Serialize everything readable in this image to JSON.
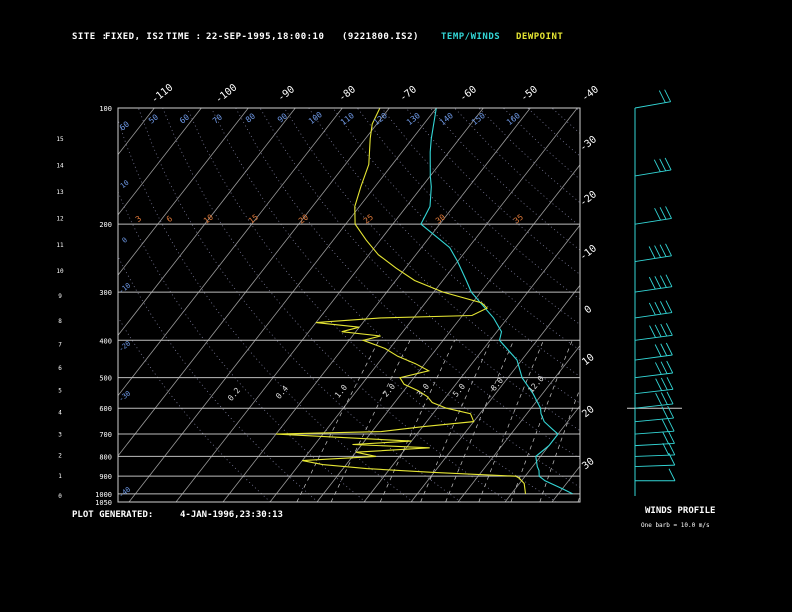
{
  "header": {
    "site_label": "SITE :",
    "site_value": "FIXED, IS2",
    "time_label": "TIME :",
    "time_value": "22-SEP-1995,18:00:10",
    "file_id": "(9221800.IS2)",
    "temp_legend": "TEMP/WINDS",
    "dew_legend": "DEWPOINT"
  },
  "colors": {
    "temp": "#33d6d6",
    "dewpoint": "#e6e633",
    "isotherm": "#9a9a9a",
    "isobar": "#bdbdbd",
    "dry_adiabat": "#7a7a9a",
    "mixing_ratio": "#c8c8c8",
    "theta_label": "#6f9ae8",
    "orange_label": "#e07a3a"
  },
  "footer": {
    "generated_label": "PLOT GENERATED:",
    "generated_value": "4-JAN-1996,23:30:13",
    "winds_title": "WINDS PROFILE",
    "winds_note": "One barb = 10.0 m/s"
  },
  "chart_data": {
    "type": "line",
    "pressure_levels": [
      100,
      200,
      300,
      400,
      500,
      600,
      700,
      800,
      900,
      1000,
      1050
    ],
    "height_ticks_km": [
      0,
      1,
      2,
      3,
      4,
      5,
      6,
      7,
      8,
      9,
      10,
      11,
      12,
      13,
      14,
      15
    ],
    "isotherm_labels_top": [
      "-110",
      "-100",
      "-90",
      "-80",
      "-70",
      "-60",
      "-50",
      "-40"
    ],
    "isotherm_labels_right": [
      "-30",
      "-20",
      "-10",
      "0",
      "10",
      "20",
      "30"
    ],
    "theta_labels": [
      "60",
      "50",
      "60",
      "70",
      "80",
      "90",
      "100",
      "110",
      "120",
      "130",
      "140",
      "150",
      "160"
    ],
    "orange_labels": [
      "3",
      "6",
      "10",
      "15",
      "20",
      "25",
      "30",
      "35"
    ],
    "mixing_ratio_labels": [
      "0.2",
      "0.4",
      "1.0",
      "2.0",
      "3.0",
      "5.0",
      "8.0",
      "12.0"
    ],
    "left_theta_labels": [
      "10",
      "0",
      "-10",
      "-20",
      "-30",
      "-40"
    ],
    "series": [
      {
        "name": "TEMP/WINDS",
        "points": [
          [
            1000,
            23
          ],
          [
            970,
            20
          ],
          [
            925,
            15
          ],
          [
            900,
            13
          ],
          [
            870,
            12
          ],
          [
            850,
            11
          ],
          [
            800,
            9
          ],
          [
            750,
            10
          ],
          [
            700,
            10
          ],
          [
            680,
            8
          ],
          [
            650,
            5
          ],
          [
            620,
            3
          ],
          [
            600,
            2
          ],
          [
            550,
            -2
          ],
          [
            500,
            -7
          ],
          [
            450,
            -11
          ],
          [
            400,
            -18
          ],
          [
            380,
            -19
          ],
          [
            350,
            -23
          ],
          [
            300,
            -32
          ],
          [
            280,
            -35
          ],
          [
            250,
            -40
          ],
          [
            230,
            -44
          ],
          [
            200,
            -54
          ],
          [
            180,
            -55
          ],
          [
            160,
            -58
          ],
          [
            150,
            -60
          ],
          [
            130,
            -64
          ],
          [
            120,
            -66
          ],
          [
            100,
            -70
          ]
        ]
      },
      {
        "name": "DEWPOINT",
        "points": [
          [
            1000,
            13
          ],
          [
            940,
            11
          ],
          [
            925,
            10
          ],
          [
            910,
            9
          ],
          [
            900,
            8
          ],
          [
            880,
            -10
          ],
          [
            860,
            -25
          ],
          [
            840,
            -35
          ],
          [
            820,
            -40
          ],
          [
            800,
            -25
          ],
          [
            780,
            -30
          ],
          [
            760,
            -15
          ],
          [
            745,
            -32
          ],
          [
            730,
            -20
          ],
          [
            700,
            -50
          ],
          [
            690,
            -28
          ],
          [
            670,
            -20
          ],
          [
            650,
            -10
          ],
          [
            620,
            -12
          ],
          [
            600,
            -18
          ],
          [
            580,
            -22
          ],
          [
            560,
            -24
          ],
          [
            540,
            -27
          ],
          [
            520,
            -31
          ],
          [
            500,
            -33
          ],
          [
            480,
            -28
          ],
          [
            460,
            -32
          ],
          [
            440,
            -37
          ],
          [
            420,
            -41
          ],
          [
            400,
            -47
          ],
          [
            390,
            -44
          ],
          [
            380,
            -53
          ],
          [
            370,
            -50
          ],
          [
            360,
            -60
          ],
          [
            350,
            -47
          ],
          [
            345,
            -28
          ],
          [
            330,
            -26
          ],
          [
            320,
            -28
          ],
          [
            300,
            -38
          ],
          [
            280,
            -46
          ],
          [
            260,
            -52
          ],
          [
            240,
            -58
          ],
          [
            220,
            -63
          ],
          [
            200,
            -68
          ],
          [
            180,
            -71
          ],
          [
            160,
            -73
          ],
          [
            140,
            -75
          ],
          [
            120,
            -79
          ],
          [
            110,
            -81
          ],
          [
            100,
            -82
          ]
        ]
      }
    ],
    "winds": [
      {
        "p": 1000,
        "speed": 0,
        "dir": 0
      },
      {
        "p": 925,
        "speed": 5,
        "dir": 180
      },
      {
        "p": 850,
        "speed": 10,
        "dir": 200
      },
      {
        "p": 800,
        "speed": 15,
        "dir": 200
      },
      {
        "p": 750,
        "speed": 15,
        "dir": 210
      },
      {
        "p": 700,
        "speed": 20,
        "dir": 220
      },
      {
        "p": 650,
        "speed": 20,
        "dir": 230
      },
      {
        "p": 600,
        "speed": 25,
        "dir": 240
      },
      {
        "p": 550,
        "speed": 25,
        "dir": 240
      },
      {
        "p": 500,
        "speed": 30,
        "dir": 245
      },
      {
        "p": 450,
        "speed": 30,
        "dir": 250
      },
      {
        "p": 400,
        "speed": 35,
        "dir": 250
      },
      {
        "p": 350,
        "speed": 35,
        "dir": 255
      },
      {
        "p": 300,
        "speed": 40,
        "dir": 255
      },
      {
        "p": 250,
        "speed": 35,
        "dir": 260
      },
      {
        "p": 200,
        "speed": 30,
        "dir": 260
      },
      {
        "p": 150,
        "speed": 25,
        "dir": 265
      },
      {
        "p": 100,
        "speed": 20,
        "dir": 270
      }
    ]
  }
}
